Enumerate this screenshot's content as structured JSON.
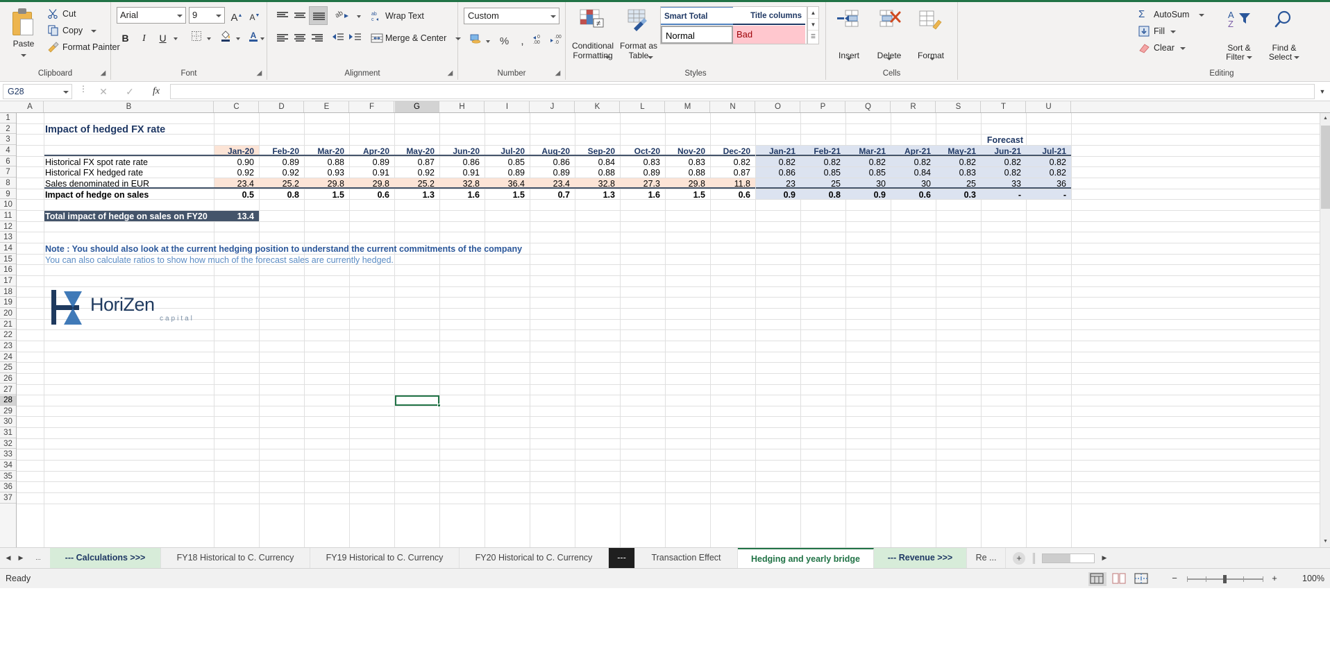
{
  "ribbon": {
    "groups": [
      {
        "name": "Clipboard",
        "label": "Clipboard"
      },
      {
        "name": "Font",
        "label": "Font"
      },
      {
        "name": "Alignment",
        "label": "Alignment"
      },
      {
        "name": "Number",
        "label": "Number"
      },
      {
        "name": "Styles",
        "label": "Styles"
      },
      {
        "name": "Cells",
        "label": "Cells"
      },
      {
        "name": "Editing",
        "label": "Editing"
      }
    ],
    "clipboard": {
      "group_label": "Clipboard",
      "paste": "Paste",
      "cut": "Cut",
      "copy": "Copy",
      "format_painter": "Format Painter"
    },
    "font": {
      "group_label": "Font",
      "font_name": "Arial",
      "font_size": "9",
      "grow": "A",
      "shrink": "A",
      "bold": "B",
      "italic": "I",
      "underline": "U"
    },
    "alignment": {
      "group_label": "Alignment",
      "wrap_text": "Wrap Text",
      "merge_center": "Merge & Center"
    },
    "number": {
      "group_label": "Number",
      "format": "Custom",
      "percent": "%",
      "comma": ",",
      "dec_dec": ".00",
      "inc_dec": ".00"
    },
    "styles": {
      "group_label": "Styles",
      "conditional_formatting": "Conditional Formatting",
      "format_as_table": "Format as Table",
      "gallery": [
        {
          "label": "Smart Total",
          "kind": "smart-total"
        },
        {
          "label": "Title columns",
          "kind": "title-columns"
        },
        {
          "label": "Normal",
          "kind": "normal"
        },
        {
          "label": "Bad",
          "kind": "bad"
        }
      ]
    },
    "cells": {
      "group_label": "Cells",
      "insert": "Insert",
      "delete": "Delete",
      "format": "Format"
    },
    "editing": {
      "group_label": "Editing",
      "autosum": "AutoSum",
      "fill": "Fill",
      "clear": "Clear",
      "sort_filter": "Sort & Filter",
      "find_select": "Find & Select"
    }
  },
  "formula_bar": {
    "name_box": "G28",
    "formula": "",
    "cancel_icon": "✕",
    "enter_icon": "✓",
    "fx_icon": "fx"
  },
  "grid": {
    "columns": [
      "A",
      "B",
      "C",
      "D",
      "E",
      "F",
      "G",
      "H",
      "I",
      "J",
      "K",
      "L",
      "M",
      "N",
      "O",
      "P",
      "Q",
      "R",
      "S",
      "T",
      "U"
    ],
    "active_column": "G",
    "rows": [
      1,
      2,
      3,
      4,
      6,
      7,
      8,
      9,
      10,
      11,
      12,
      13,
      14,
      15,
      16,
      17,
      18,
      19,
      20,
      21,
      22,
      23,
      24,
      25,
      26,
      27,
      28,
      29,
      30,
      31,
      32,
      33,
      34,
      35,
      36,
      37
    ],
    "active_row": 28,
    "selected_cell": "G28"
  },
  "sheet": {
    "title": "Impact of hedged FX rate",
    "forecast_label": "Forecast",
    "periods": [
      "Jan-20",
      "Feb-20",
      "Mar-20",
      "Apr-20",
      "May-20",
      "Jun-20",
      "Jul-20",
      "Aug-20",
      "Sep-20",
      "Oct-20",
      "Nov-20",
      "Dec-20",
      "Jan-21",
      "Feb-21",
      "Mar-21",
      "Apr-21",
      "May-21",
      "Jun-21",
      "Jul-21"
    ],
    "rows": [
      {
        "label": "Historical FX spot rate rate",
        "values": [
          "0.90",
          "0.89",
          "0.88",
          "0.89",
          "0.87",
          "0.86",
          "0.85",
          "0.86",
          "0.84",
          "0.83",
          "0.83",
          "0.82",
          "0.82",
          "0.82",
          "0.82",
          "0.82",
          "0.82",
          "0.82",
          "0.82"
        ]
      },
      {
        "label": "Historical FX hedged rate",
        "values": [
          "0.92",
          "0.92",
          "0.93",
          "0.91",
          "0.92",
          "0.91",
          "0.89",
          "0.89",
          "0.88",
          "0.89",
          "0.88",
          "0.87",
          "0.86",
          "0.85",
          "0.85",
          "0.84",
          "0.83",
          "0.82",
          "0.82"
        ]
      },
      {
        "label": "Sales denominated in EUR",
        "values": [
          "23.4",
          "25.2",
          "29.8",
          "29.8",
          "25.2",
          "32.8",
          "36.4",
          "23.4",
          "32.8",
          "27.3",
          "29.8",
          "11.8",
          "23",
          "25",
          "30",
          "30",
          "25",
          "33",
          "36"
        ]
      },
      {
        "label": "Impact of hedge on sales",
        "values": [
          "0.5",
          "0.8",
          "1.5",
          "0.6",
          "1.3",
          "1.6",
          "1.5",
          "0.7",
          "1.3",
          "1.6",
          "1.5",
          "0.6",
          "0.9",
          "0.8",
          "0.9",
          "0.6",
          "0.3",
          "-",
          "-"
        ]
      }
    ],
    "total": {
      "label": "Total impact of hedge on sales on FY20",
      "value": "13.4"
    },
    "note_bold": "Note : You should also look at the current hedging position to understand the current commitments of the company",
    "note_light": "You can also calculate ratios to show how much of the forecast sales are currently hedged.",
    "logo": {
      "name": "HoriZen",
      "tagline": "capital"
    }
  },
  "tabs": {
    "items": [
      {
        "label": "--- Calculations >>>",
        "style": "green"
      },
      {
        "label": "FY18 Historical to C. Currency",
        "style": "normal"
      },
      {
        "label": "FY19 Historical to C. Currency",
        "style": "normal"
      },
      {
        "label": "FY20 Historical to C. Currency",
        "style": "normal"
      },
      {
        "label": "---",
        "style": "dark"
      },
      {
        "label": "Transaction Effect",
        "style": "normal"
      },
      {
        "label": "Hedging and yearly bridge",
        "style": "active"
      },
      {
        "label": "--- Revenue >>>",
        "style": "green"
      },
      {
        "label": "Re ...",
        "style": "normal"
      }
    ],
    "add_sheet": "+",
    "nav_first": "◀",
    "nav_prev": "◀",
    "nav_next": "▶",
    "nav_ellipsis": "..."
  },
  "status": {
    "ready": "Ready",
    "zoom": "100%",
    "views": [
      "normal-view",
      "page-layout-view",
      "page-break-view"
    ]
  },
  "colors": {
    "accent_green": "#217346",
    "header_blue": "#1f3864",
    "forecast_fill": "#dce3f0",
    "highlight_fill": "#fce4d6",
    "total_fill": "#44546a",
    "bad_fill": "#ffc7ce",
    "bad_text": "#9c0006"
  }
}
